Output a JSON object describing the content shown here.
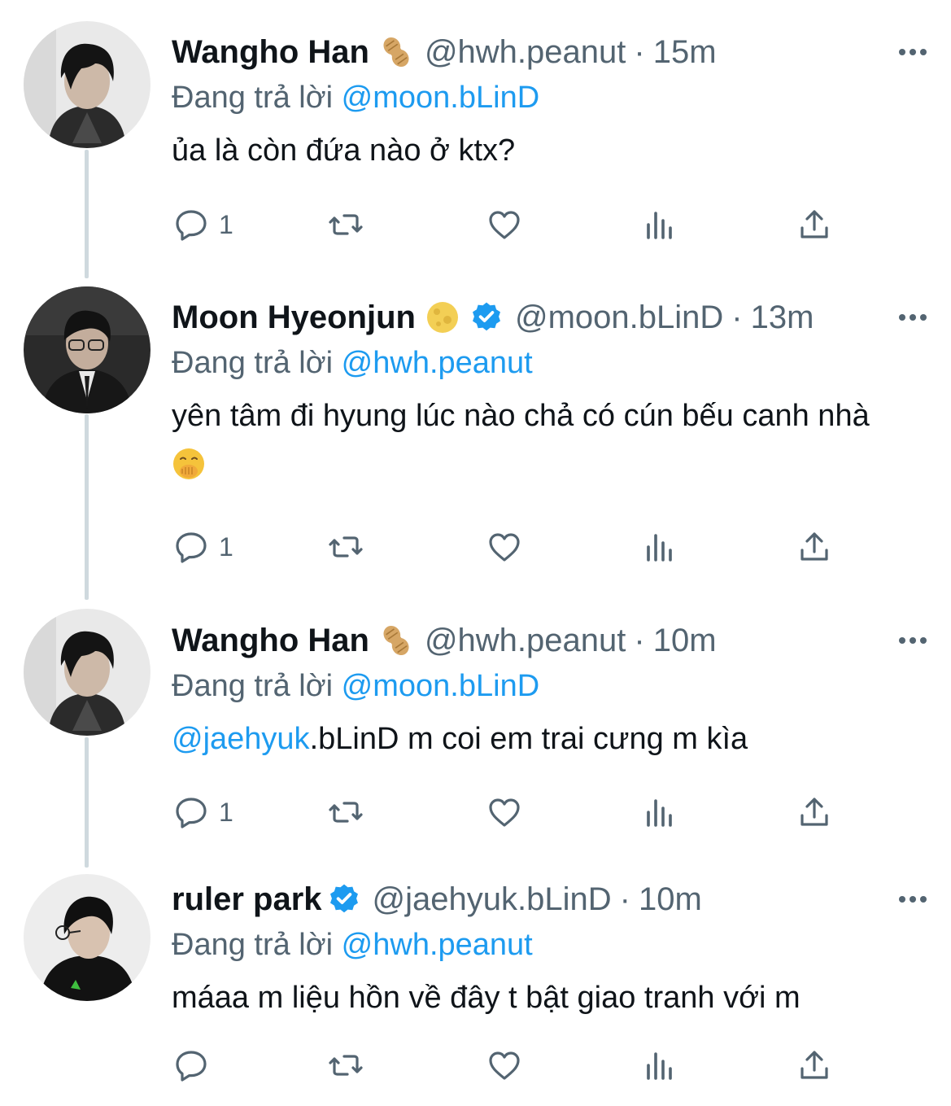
{
  "thread": [
    {
      "display_name": "Wangho Han",
      "name_emoji": "peanut-emoji",
      "verified": false,
      "handle": "@hwh.peanut",
      "separator": "·",
      "time": "15m",
      "reply_prefix": "Đang trả lời",
      "reply_to": "@moon.bLinD",
      "text_mention": "",
      "text": "ủa là còn đứa nào ở ktx?",
      "reply_count": "1"
    },
    {
      "display_name": "Moon Hyeonjun",
      "name_emoji": "full-moon-emoji",
      "verified": true,
      "handle": "@moon.bLinD",
      "separator": "·",
      "time": "13m",
      "reply_prefix": "Đang trả lời",
      "reply_to": "@hwh.peanut",
      "text_mention": "",
      "text": "yên tâm đi hyung lúc nào chả có cún bếu canh nhà",
      "text_emoji": "hand-over-mouth-emoji",
      "reply_count": "1"
    },
    {
      "display_name": "Wangho Han",
      "name_emoji": "peanut-emoji",
      "verified": false,
      "handle": "@hwh.peanut",
      "separator": "·",
      "time": "10m",
      "reply_prefix": "Đang trả lời",
      "reply_to": "@moon.bLinD",
      "text_mention": "@jaehyuk",
      "text": ".bLinD m coi em trai cưng m kìa",
      "reply_count": "1"
    },
    {
      "display_name": "ruler park",
      "verified": true,
      "handle": "@jaehyuk.bLinD",
      "separator": "·",
      "time": "10m",
      "reply_prefix": "Đang trả lời",
      "reply_to": "@hwh.peanut",
      "text_mention": "",
      "text": "máaa m liệu hồn về đây t bật giao tranh với m",
      "reply_count": ""
    }
  ],
  "icons": {
    "reply": "reply-icon",
    "retweet": "retweet-icon",
    "like": "like-icon",
    "views": "views-icon",
    "share": "share-icon",
    "more": "more-icon",
    "verified": "verified-badge-icon"
  },
  "colors": {
    "link": "#1d9bf0",
    "secondary_text": "#536471",
    "primary_text": "#0f1419",
    "thread_line": "#cfd9de"
  }
}
